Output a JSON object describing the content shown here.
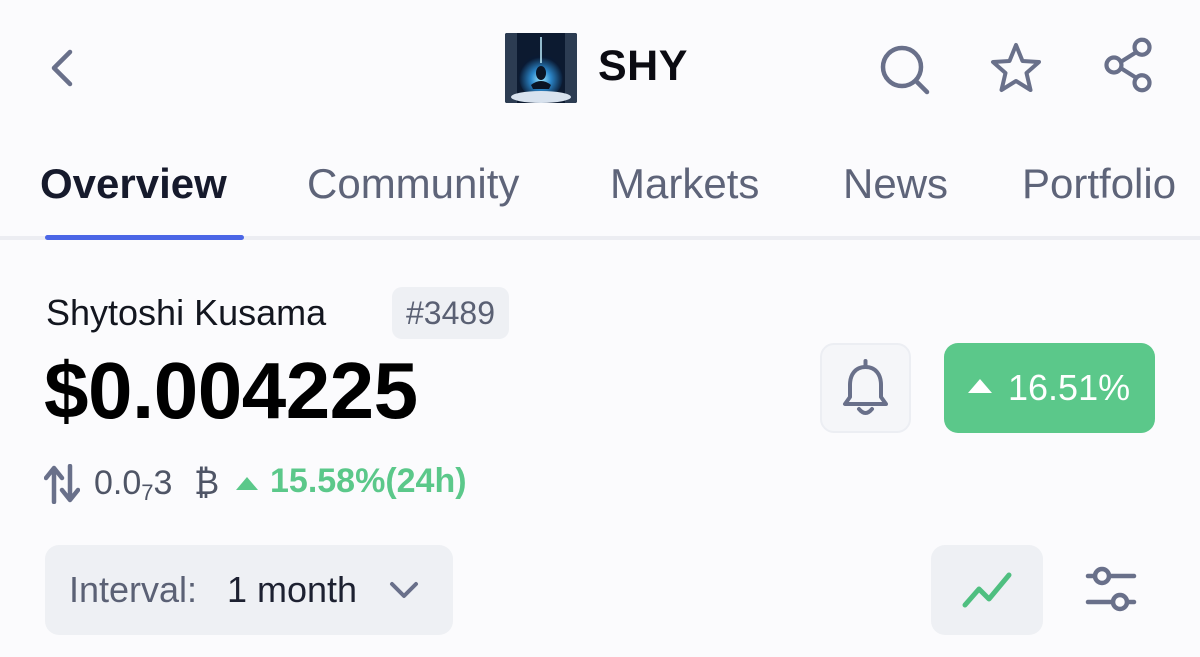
{
  "header": {
    "symbol": "SHY",
    "icons": [
      "back-icon",
      "search-icon",
      "star-icon",
      "share-icon"
    ]
  },
  "tabs": [
    {
      "label": "Overview",
      "active": true
    },
    {
      "label": "Community",
      "active": false
    },
    {
      "label": "Markets",
      "active": false
    },
    {
      "label": "News",
      "active": false
    },
    {
      "label": "Portfolio",
      "active": false
    }
  ],
  "coin": {
    "name": "Shytoshi Kusama",
    "rank": "#3489",
    "price": "$0.004225",
    "change_pct": "16.51%",
    "btc_prefix": "0.0",
    "btc_zeros_sub": "7",
    "btc_digit": "3",
    "btc_symbol": "₿",
    "btc_change": "15.58%(24h)"
  },
  "controls": {
    "interval_label": "Interval:",
    "interval_value": "1 month"
  },
  "colors": {
    "accent": "#4b66e6",
    "positive": "#5bc88a",
    "muted": "#5e6479"
  }
}
